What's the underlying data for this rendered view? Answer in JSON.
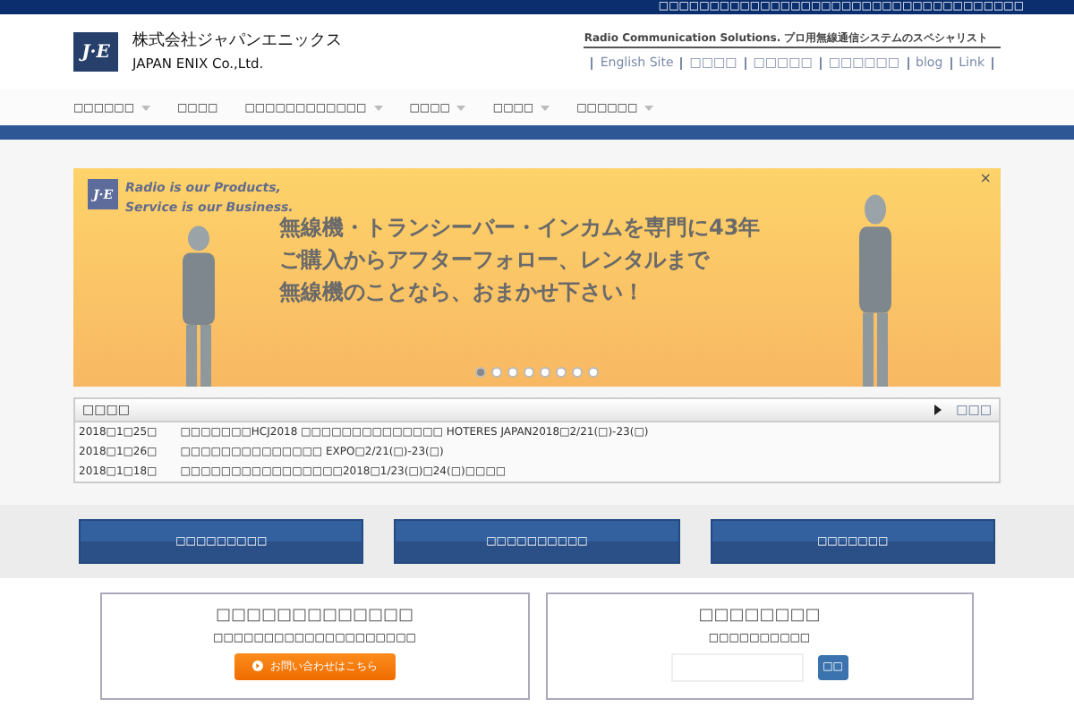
{
  "top_bar": {
    "text": "□□□□□□□□□□□□□□□□□□□□□□□□□□□□□□□□□□□□"
  },
  "logo": {
    "mark": "J·E",
    "name_ja": "株式会社ジャパンエニックス",
    "name_en": "JAPAN ENIX Co.,Ltd."
  },
  "tagline": "Radio Communication Solutions. プロ用無線通信システムのスペシャリスト",
  "header_links": [
    "English Site",
    "□□□□",
    "□□□□□",
    "□□□□□□",
    "blog",
    "Link"
  ],
  "nav": [
    {
      "label": "□□□□□□",
      "dropdown": true
    },
    {
      "label": "□□□□",
      "dropdown": false
    },
    {
      "label": "□□□□□□□□□□□□",
      "dropdown": true
    },
    {
      "label": "□□□□",
      "dropdown": true
    },
    {
      "label": "□□□□",
      "dropdown": true
    },
    {
      "label": "□□□□□□",
      "dropdown": true
    }
  ],
  "banner": {
    "mark": "J·E",
    "slogan": [
      "Radio is our Products,",
      "Service is our Business."
    ],
    "headline": [
      "無線機・トランシーバー・インカムを専門に43年",
      "ご購入からアフターフォロー、レンタルまで",
      "無線機のことなら、おまかせ下さい！"
    ],
    "close": "×",
    "dots": [
      {
        "selected": true
      },
      {
        "selected": false
      },
      {
        "selected": false
      },
      {
        "selected": false
      },
      {
        "selected": false
      },
      {
        "selected": false
      },
      {
        "selected": false
      },
      {
        "selected": false
      }
    ]
  },
  "news": {
    "title": "□□□□",
    "more": "□□□",
    "rows": [
      {
        "date": "2018□1□25□",
        "text": "□□□□□□□HCJ2018 □□□□□□□□□□□□□□ HOTERES JAPAN2018□2/21(□)-23(□)"
      },
      {
        "date": "2018□1□26□",
        "text": "□□□□□□□□□□□□□□ EXPO□2/21(□)-23(□)"
      },
      {
        "date": "2018□1□18□",
        "text": "□□□□□□□□□□□□□□□□2018□1/23(□)□24(□)□□□□"
      }
    ]
  },
  "feature_buttons": [
    "□□□□□□□□□",
    "□□□□□□□□□□",
    "□□□□□□□"
  ],
  "contact": {
    "title": "□□□□□□□□□□□□□",
    "subtitle": "□□□□□□□□□□□□□□□□□□□□",
    "button": "お問い合わせはこちら"
  },
  "search": {
    "title": "□□□□□□□□",
    "subtitle": "□□□□□□□□□□",
    "button": "□□"
  }
}
